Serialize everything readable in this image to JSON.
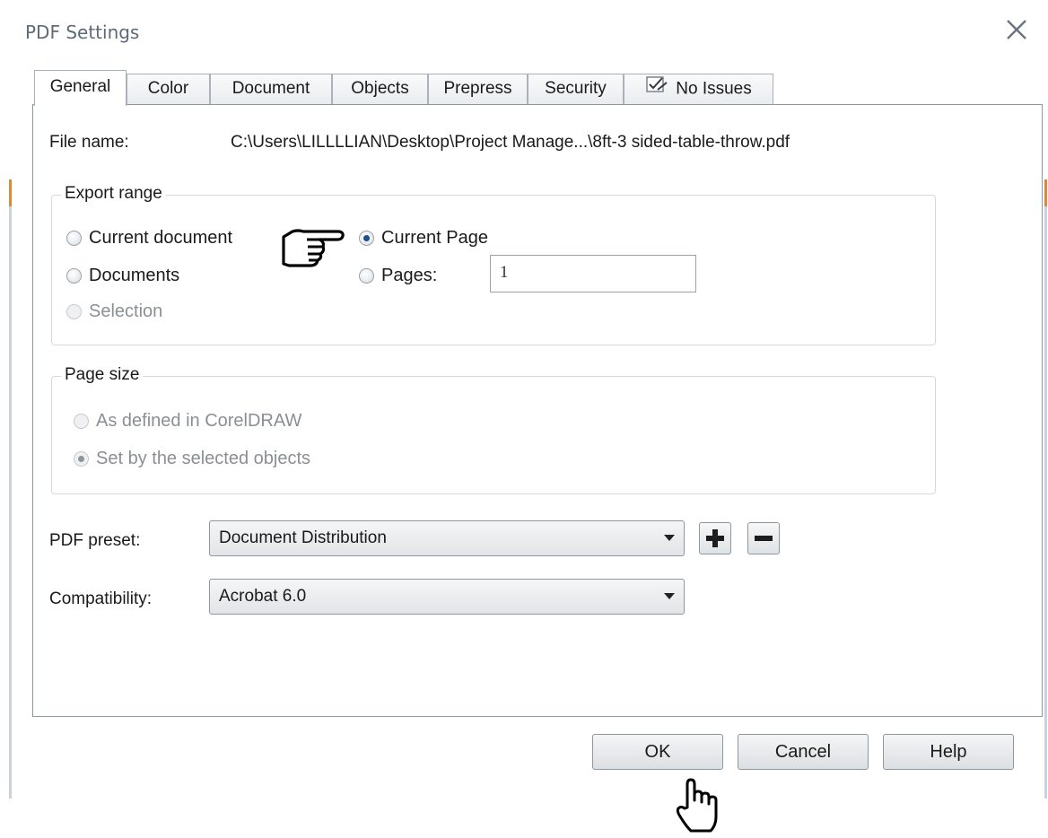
{
  "window": {
    "title": "PDF Settings"
  },
  "tabs": [
    {
      "label": "General"
    },
    {
      "label": "Color"
    },
    {
      "label": "Document"
    },
    {
      "label": "Objects"
    },
    {
      "label": "Prepress"
    },
    {
      "label": "Security"
    },
    {
      "label": "No Issues"
    }
  ],
  "file": {
    "label": "File name:",
    "value": "C:\\Users\\LILLLLIAN\\Desktop\\Project Manage...\\8ft-3 sided-table-throw.pdf"
  },
  "export_range": {
    "title": "Export range",
    "current_document": "Current document",
    "documents": "Documents",
    "selection": "Selection",
    "current_page": "Current Page",
    "pages": "Pages:",
    "pages_value": "1"
  },
  "page_size": {
    "title": "Page size",
    "as_defined": "As defined in CorelDRAW",
    "set_by_selected": "Set by the selected objects"
  },
  "preset": {
    "label": "PDF preset:",
    "value": "Document Distribution"
  },
  "compatibility": {
    "label": "Compatibility:",
    "value": "Acrobat 6.0"
  },
  "buttons": {
    "ok": "OK",
    "cancel": "Cancel",
    "help": "Help"
  },
  "colors": {
    "border": "#8e969f",
    "radio_checked": "#1f4f8a",
    "accent_edge": "#e0883a"
  },
  "icons": {
    "close": "close-icon",
    "tab_check": "checklist-icon",
    "add": "plus-icon",
    "remove": "minus-icon",
    "pointing_hand": "pointing-hand-icon",
    "cursor_hand": "hand-cursor-icon"
  }
}
